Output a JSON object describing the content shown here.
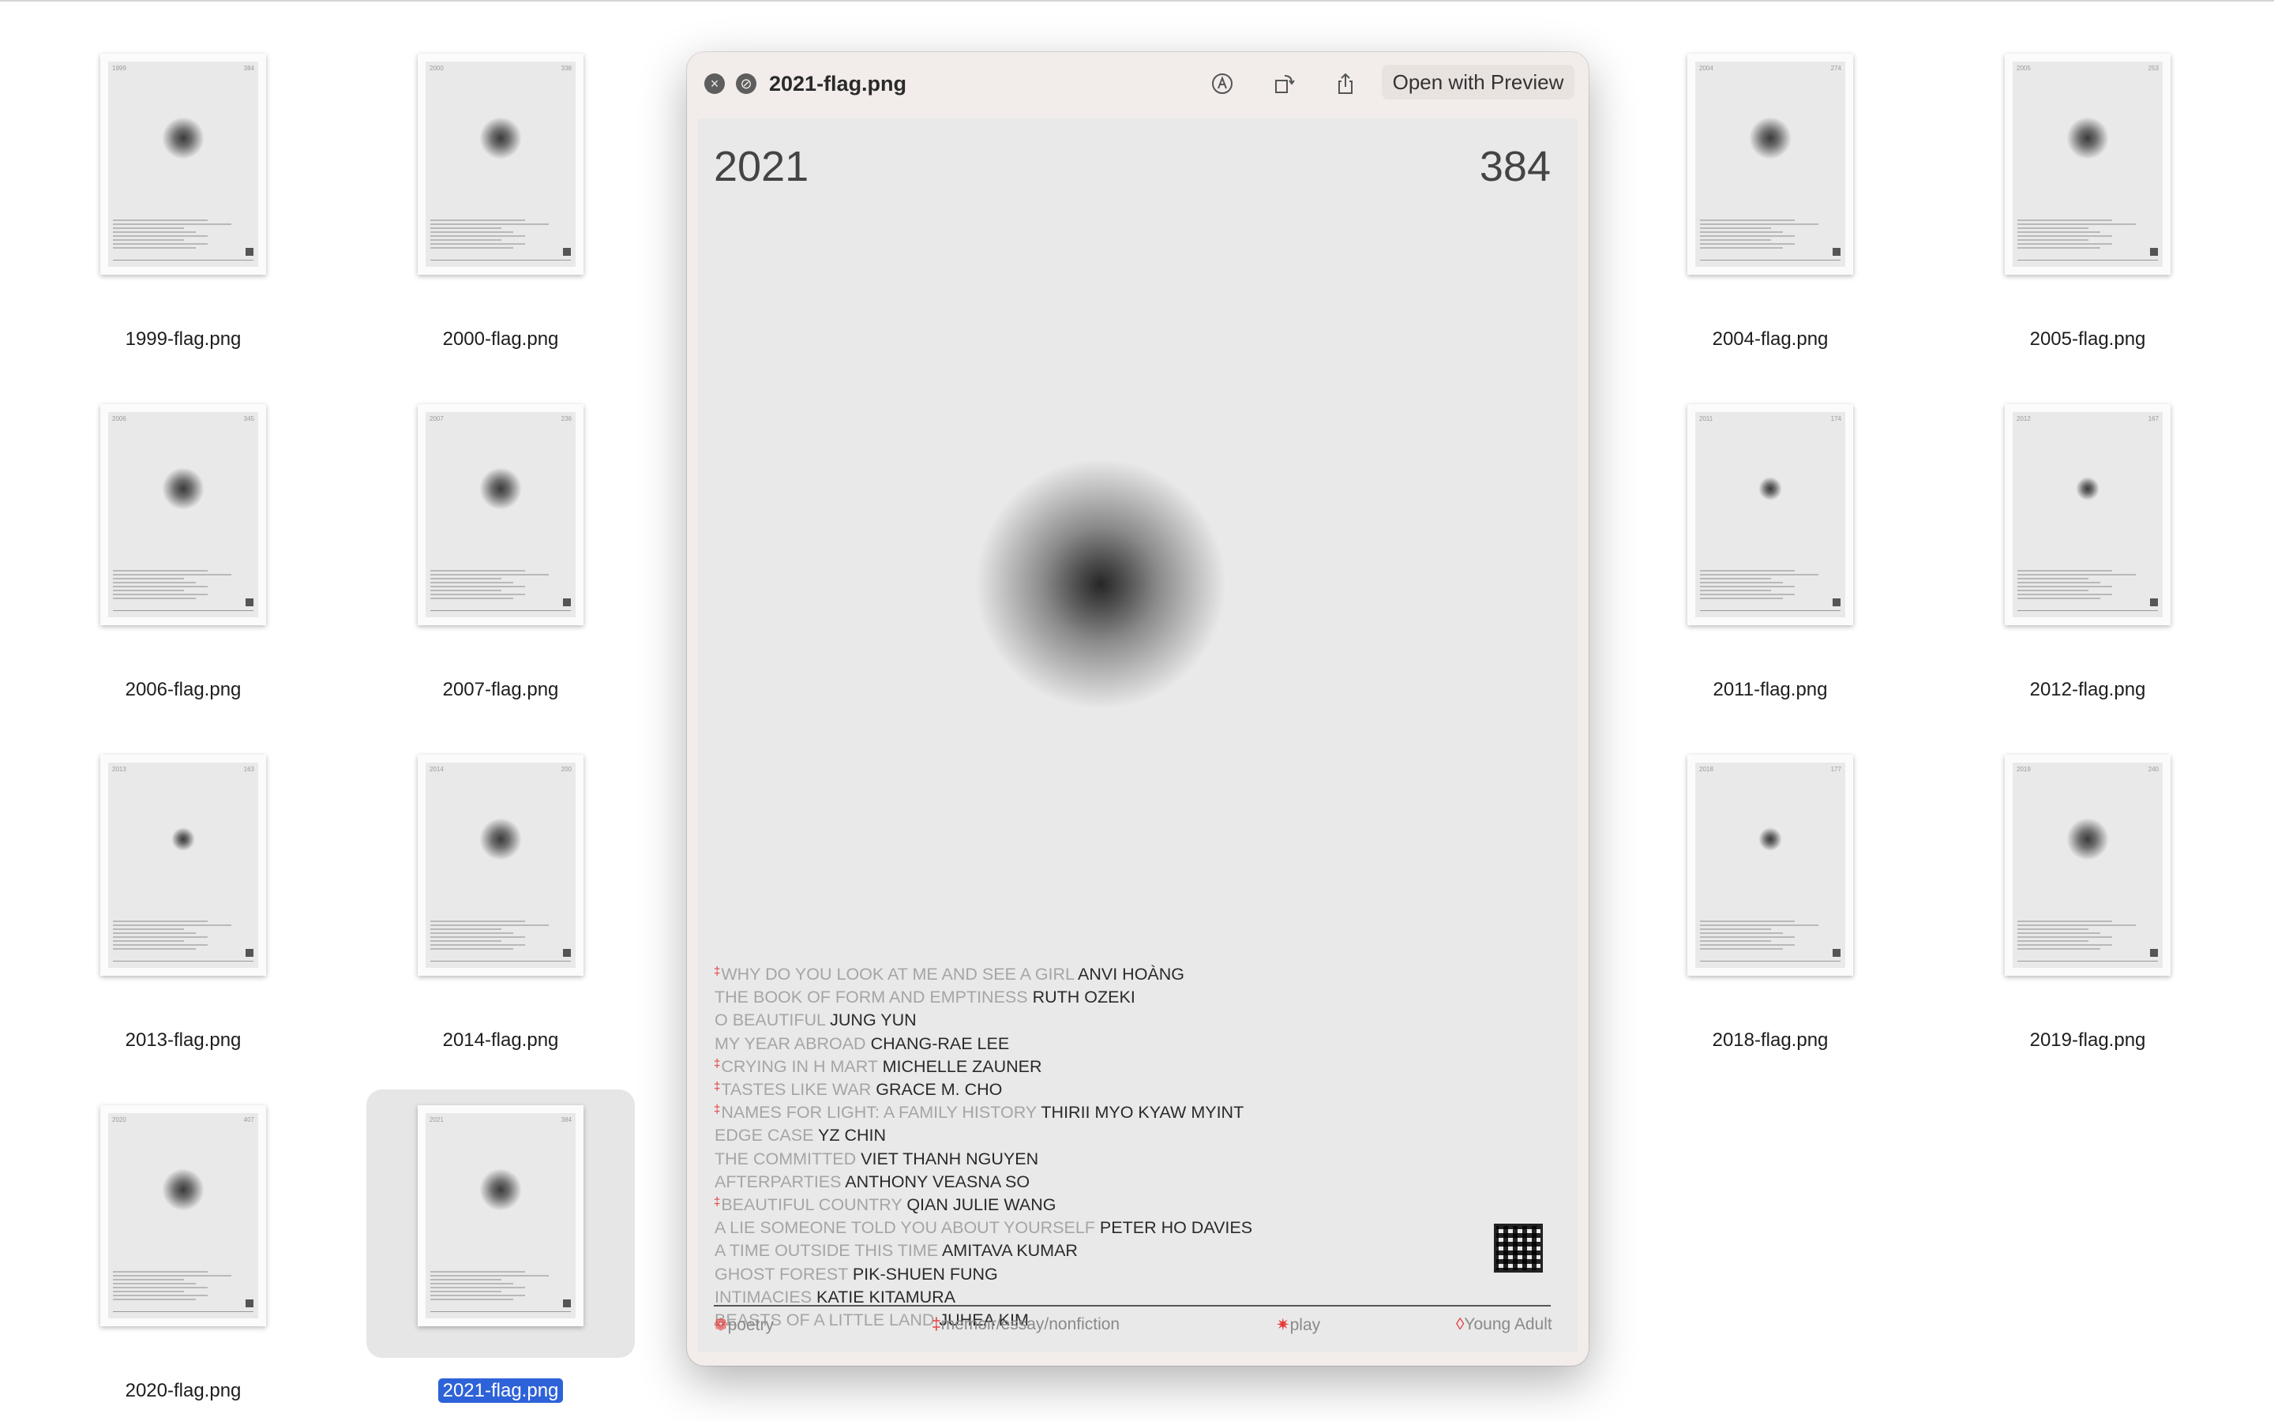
{
  "files": [
    {
      "name": "1999-flag.png",
      "year": "1999",
      "count": "384"
    },
    {
      "name": "2000-flag.png",
      "year": "2000",
      "count": "338"
    },
    {
      "name": "2004-flag.png",
      "year": "2004",
      "count": "274"
    },
    {
      "name": "2005-flag.png",
      "year": "2005",
      "count": "253"
    },
    {
      "name": "2006-flag.png",
      "year": "2006",
      "count": "345"
    },
    {
      "name": "2007-flag.png",
      "year": "2007",
      "count": "236"
    },
    {
      "name": "2011-flag.png",
      "year": "2011",
      "count": "174"
    },
    {
      "name": "2012-flag.png",
      "year": "2012",
      "count": "167"
    },
    {
      "name": "2013-flag.png",
      "year": "2013",
      "count": "163"
    },
    {
      "name": "2014-flag.png",
      "year": "2014",
      "count": "200"
    },
    {
      "name": "2018-flag.png",
      "year": "2018",
      "count": "177"
    },
    {
      "name": "2019-flag.png",
      "year": "2019",
      "count": "240"
    },
    {
      "name": "2020-flag.png",
      "year": "2020",
      "count": "407"
    },
    {
      "name": "2021-flag.png",
      "year": "2021",
      "count": "384",
      "selected": true
    }
  ],
  "quicklook": {
    "title": "2021-flag.png",
    "open_button": "Open with Preview",
    "icons": [
      "close-icon",
      "block-icon",
      "markup-icon",
      "rotate-icon",
      "share-icon"
    ]
  },
  "document": {
    "year": "2021",
    "count": "384",
    "books": [
      {
        "marker": "‡",
        "title": "WHY DO YOU LOOK AT ME AND SEE A GIRL",
        "author": "ANVI HOÀNG"
      },
      {
        "marker": "",
        "title": "THE BOOK OF FORM AND EMPTINESS",
        "author": "RUTH OZEKI"
      },
      {
        "marker": "",
        "title": "O BEAUTIFUL",
        "author": "JUNG YUN"
      },
      {
        "marker": "",
        "title": "MY YEAR ABROAD",
        "author": "CHANG-RAE LEE"
      },
      {
        "marker": "‡",
        "title": "CRYING IN H MART",
        "author": "MICHELLE ZAUNER"
      },
      {
        "marker": "‡",
        "title": "TASTES LIKE WAR",
        "author": "GRACE M. CHO"
      },
      {
        "marker": "‡",
        "title": "NAMES FOR LIGHT: A FAMILY HISTORY",
        "author": "THIRII MYO KYAW MYINT"
      },
      {
        "marker": "",
        "title": "EDGE CASE",
        "author": "YZ CHIN"
      },
      {
        "marker": "",
        "title": "THE COMMITTED",
        "author": "VIET THANH NGUYEN"
      },
      {
        "marker": "",
        "title": "AFTERPARTIES",
        "author": "ANTHONY VEASNA SO"
      },
      {
        "marker": "‡",
        "title": "BEAUTIFUL COUNTRY",
        "author": "QIAN JULIE WANG"
      },
      {
        "marker": "",
        "title": "A LIE SOMEONE TOLD YOU ABOUT YOURSELF",
        "author": "PETER HO DAVIES"
      },
      {
        "marker": "",
        "title": "A TIME OUTSIDE THIS TIME",
        "author": "AMITAVA KUMAR"
      },
      {
        "marker": "",
        "title": "GHOST FOREST",
        "author": "PIK-SHUEN FUNG"
      },
      {
        "marker": "",
        "title": "INTIMACIES",
        "author": "KATIE KITAMURA"
      },
      {
        "marker": "",
        "title": "BEASTS OF A LITTLE LAND",
        "author": "JUHEA KIM"
      }
    ],
    "legend": [
      {
        "symbol": "❁",
        "label": "poetry"
      },
      {
        "symbol": "‡",
        "label": "memoir/essay/nonfiction"
      },
      {
        "symbol": "✷",
        "label": "play"
      },
      {
        "symbol": "◊",
        "label": "Young Adult"
      }
    ]
  },
  "colors": {
    "selection": "#2e62d8",
    "marker_red": "#e53b3b",
    "poster_bg": "#e9e9e9"
  }
}
